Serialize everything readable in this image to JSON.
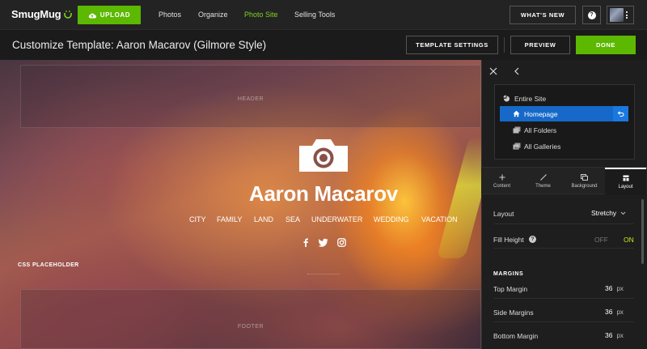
{
  "topnav": {
    "logo": "SmugMug",
    "upload_label": "UPLOAD",
    "links": [
      {
        "label": "Photos",
        "active": false
      },
      {
        "label": "Organize",
        "active": false
      },
      {
        "label": "Photo Site",
        "active": true
      },
      {
        "label": "Selling Tools",
        "active": false
      }
    ],
    "whats_new_label": "WHAT'S NEW",
    "help_label": "?"
  },
  "subbar": {
    "title": "Customize Template: Aaron Macarov (Gilmore Style)",
    "template_settings_label": "TEMPLATE SETTINGS",
    "preview_label": "PREVIEW",
    "done_label": "DONE"
  },
  "canvas": {
    "header_label": "HEADER",
    "footer_label": "FOOTER",
    "site_name": "Aaron Macarov",
    "nav": [
      "CITY",
      "FAMILY",
      "LAND",
      "SEA",
      "UNDERWATER",
      "WEDDING",
      "VACATION"
    ],
    "social_icons": [
      "facebook-icon",
      "twitter-icon",
      "instagram-icon"
    ],
    "css_placeholder": "CSS PLACEHOLDER"
  },
  "panel": {
    "tree": [
      {
        "label": "Entire Site",
        "icon": "site-icon",
        "selected": false
      },
      {
        "label": "Homepage",
        "icon": "home-icon",
        "selected": true
      },
      {
        "label": "All Folders",
        "icon": "folders-icon",
        "selected": false
      },
      {
        "label": "All Galleries",
        "icon": "galleries-icon",
        "selected": false
      }
    ],
    "tabs": [
      {
        "label": "Content",
        "icon": "plus-icon",
        "active": false
      },
      {
        "label": "Theme",
        "icon": "brush-icon",
        "active": false
      },
      {
        "label": "Background",
        "icon": "background-icon",
        "active": false
      },
      {
        "label": "Layout",
        "icon": "layout-icon",
        "active": true
      }
    ],
    "layout_label": "Layout",
    "layout_value": "Stretchy",
    "fill_height_label": "Fill Height",
    "fill_height_off": "OFF",
    "fill_height_on": "ON",
    "margins_heading": "MARGINS",
    "top_margin_label": "Top Margin",
    "top_margin_value": "36",
    "side_margins_label": "Side Margins",
    "side_margins_value": "36",
    "bottom_margin_label": "Bottom Margin",
    "bottom_margin_value": "36",
    "unit": "px"
  },
  "colors": {
    "accent_green": "#5cb800",
    "active_link": "#7ed321",
    "selection_blue": "#1669c9",
    "on_toggle": "#c6e81a"
  }
}
